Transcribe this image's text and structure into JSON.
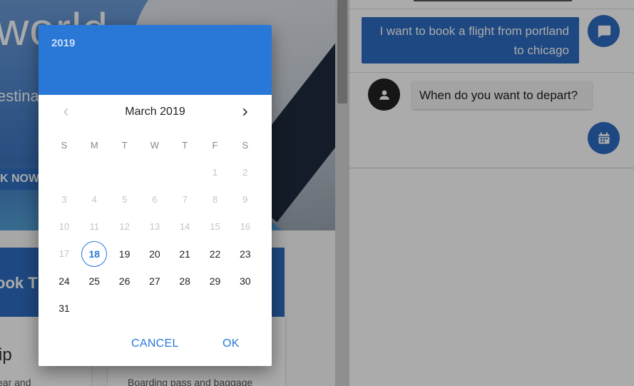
{
  "background_page": {
    "hero_title": "world",
    "hero_subtitle": "estina",
    "hero_cta": "K NOW",
    "book_card_text": "ook T",
    "column1_title": "ip",
    "column1_text": "ear and",
    "column2_text": "Boarding pass and baggage"
  },
  "chat": {
    "user_message": "I want to book a flight from portland to chicago",
    "bot_message": "When do you want to depart?",
    "icons": {
      "user_avatar": "chat-bubble-icon",
      "bot_avatar": "person-icon",
      "calendar_button": "calendar-icon"
    }
  },
  "date_picker": {
    "header_year": "2019",
    "month_label": "March 2019",
    "weekdays": [
      "S",
      "M",
      "T",
      "W",
      "T",
      "F",
      "S"
    ],
    "days": [
      {
        "label": "1",
        "state": "disabled"
      },
      {
        "label": "2",
        "state": "disabled"
      },
      {
        "label": "3",
        "state": "disabled"
      },
      {
        "label": "4",
        "state": "disabled"
      },
      {
        "label": "5",
        "state": "disabled"
      },
      {
        "label": "6",
        "state": "disabled"
      },
      {
        "label": "7",
        "state": "disabled"
      },
      {
        "label": "8",
        "state": "disabled"
      },
      {
        "label": "9",
        "state": "disabled"
      },
      {
        "label": "10",
        "state": "disabled"
      },
      {
        "label": "11",
        "state": "disabled"
      },
      {
        "label": "12",
        "state": "disabled"
      },
      {
        "label": "13",
        "state": "disabled"
      },
      {
        "label": "14",
        "state": "disabled"
      },
      {
        "label": "15",
        "state": "disabled"
      },
      {
        "label": "16",
        "state": "disabled"
      },
      {
        "label": "17",
        "state": "disabled"
      },
      {
        "label": "18",
        "state": "today"
      },
      {
        "label": "19",
        "state": "enabled"
      },
      {
        "label": "20",
        "state": "enabled"
      },
      {
        "label": "21",
        "state": "enabled"
      },
      {
        "label": "22",
        "state": "enabled"
      },
      {
        "label": "23",
        "state": "enabled"
      },
      {
        "label": "24",
        "state": "enabled"
      },
      {
        "label": "25",
        "state": "enabled"
      },
      {
        "label": "26",
        "state": "enabled"
      },
      {
        "label": "27",
        "state": "enabled"
      },
      {
        "label": "28",
        "state": "enabled"
      },
      {
        "label": "29",
        "state": "enabled"
      },
      {
        "label": "30",
        "state": "enabled"
      },
      {
        "label": "31",
        "state": "enabled"
      }
    ],
    "cancel_label": "CANCEL",
    "ok_label": "OK",
    "icons": {
      "prev": "chevron-left-icon",
      "next": "chevron-right-icon"
    }
  },
  "colors": {
    "accent": "#2978d8",
    "chat_blue": "#2e6cc0",
    "disabled_day": "#c4c4c4",
    "overlay": "rgba(0,0,0,0.33)"
  }
}
